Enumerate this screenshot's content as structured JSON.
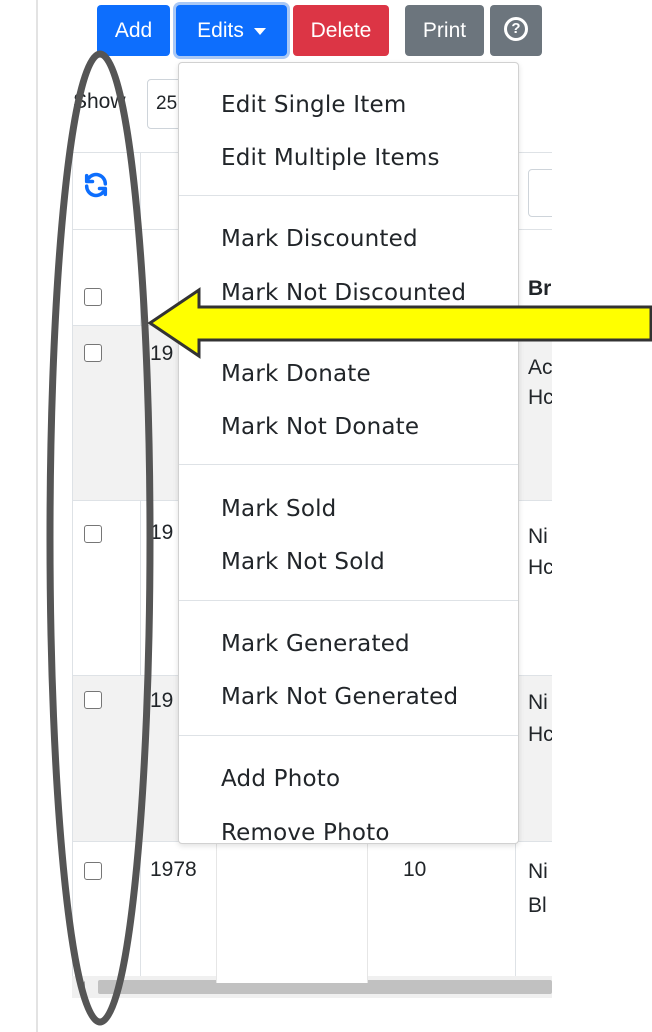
{
  "toolbar": {
    "add_label": "Add",
    "edits_label": "Edits",
    "delete_label": "Delete",
    "print_label": "Print",
    "help_label": "?"
  },
  "show": {
    "label": "Show",
    "value": "25"
  },
  "table": {
    "header": {
      "brand_label": "Br"
    },
    "rows": [
      {
        "col2": "19",
        "col4_line1": "Ac",
        "col4_line2": "Hc"
      },
      {
        "col2": "19",
        "col4_line1": "Ni",
        "col4_line2": "Hc"
      },
      {
        "col2": "19",
        "col4_line1": "Ni",
        "col4_line2": "Hc"
      },
      {
        "col2": "1978",
        "col3": "10",
        "col4_line1": "Ni",
        "col4_line2": "Bl"
      }
    ]
  },
  "dropdown": {
    "items": [
      "Edit Single Item",
      "Edit Multiple Items",
      "Mark Discounted",
      "Mark Not Discounted",
      "Mark Donate",
      "Mark Not Donate",
      "Mark Sold",
      "Mark Not Sold",
      "Mark Generated",
      "Mark Not Generated",
      "Add Photo",
      "Remove Photo"
    ]
  },
  "colors": {
    "primary": "#0d6efd",
    "danger": "#dc3545",
    "secondary": "#6c757d",
    "arrow_fill": "#ffff00",
    "annotation_outline": "#555555"
  },
  "icons": {
    "refresh": "refresh-icon",
    "help": "question-circle-icon",
    "caret": "caret-down-icon"
  }
}
